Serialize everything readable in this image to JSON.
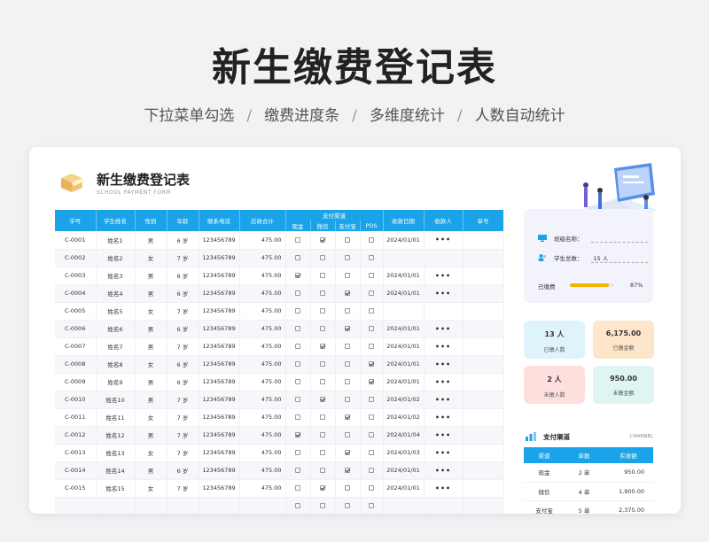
{
  "hero": {
    "title": "新生缴费登记表",
    "features": [
      "下拉菜单勾选",
      "缴费进度条",
      "多维度统计",
      "人数自动统计"
    ],
    "separator": "/"
  },
  "form": {
    "title": "新生缴费登记表",
    "subtitle": "SCHOOL PAYMENT FORM",
    "columns": [
      "学号",
      "学生姓名",
      "性别",
      "年龄",
      "联系电话",
      "应收合计",
      "支付渠道",
      "收款日期",
      "收款人",
      "单号"
    ],
    "pay_channels": [
      "现金",
      "微信",
      "支付宝",
      "POS"
    ],
    "rows": [
      {
        "id": "C-0001",
        "name": "姓名1",
        "gender": "男",
        "age": "6 岁",
        "phone": "123456789",
        "amount": "475.00",
        "pay": [
          0,
          1,
          0,
          0
        ],
        "date": "2024/01/01",
        "receiver": "•••"
      },
      {
        "id": "C-0002",
        "name": "姓名2",
        "gender": "女",
        "age": "7 岁",
        "phone": "123456789",
        "amount": "475.00",
        "pay": [
          0,
          0,
          0,
          0
        ],
        "date": "",
        "receiver": ""
      },
      {
        "id": "C-0003",
        "name": "姓名3",
        "gender": "男",
        "age": "6 岁",
        "phone": "123456789",
        "amount": "475.00",
        "pay": [
          1,
          0,
          0,
          0
        ],
        "date": "2024/01/01",
        "receiver": "•••"
      },
      {
        "id": "C-0004",
        "name": "姓名4",
        "gender": "男",
        "age": "6 岁",
        "phone": "123456789",
        "amount": "475.00",
        "pay": [
          0,
          0,
          1,
          0
        ],
        "date": "2024/01/01",
        "receiver": "•••"
      },
      {
        "id": "C-0005",
        "name": "姓名5",
        "gender": "女",
        "age": "7 岁",
        "phone": "123456789",
        "amount": "475.00",
        "pay": [
          0,
          0,
          0,
          0
        ],
        "date": "",
        "receiver": ""
      },
      {
        "id": "C-0006",
        "name": "姓名6",
        "gender": "男",
        "age": "6 岁",
        "phone": "123456789",
        "amount": "475.00",
        "pay": [
          0,
          0,
          1,
          0
        ],
        "date": "2024/01/01",
        "receiver": "•••"
      },
      {
        "id": "C-0007",
        "name": "姓名7",
        "gender": "男",
        "age": "7 岁",
        "phone": "123456789",
        "amount": "475.00",
        "pay": [
          0,
          1,
          0,
          0
        ],
        "date": "2024/01/01",
        "receiver": "•••"
      },
      {
        "id": "C-0008",
        "name": "姓名8",
        "gender": "女",
        "age": "6 岁",
        "phone": "123456789",
        "amount": "475.00",
        "pay": [
          0,
          0,
          0,
          1
        ],
        "date": "2024/01/01",
        "receiver": "•••"
      },
      {
        "id": "C-0009",
        "name": "姓名9",
        "gender": "男",
        "age": "6 岁",
        "phone": "123456789",
        "amount": "475.00",
        "pay": [
          0,
          0,
          0,
          1
        ],
        "date": "2024/01/01",
        "receiver": "•••"
      },
      {
        "id": "C-0010",
        "name": "姓名10",
        "gender": "男",
        "age": "7 岁",
        "phone": "123456789",
        "amount": "475.00",
        "pay": [
          0,
          1,
          0,
          0
        ],
        "date": "2024/01/02",
        "receiver": "•••"
      },
      {
        "id": "C-0011",
        "name": "姓名11",
        "gender": "女",
        "age": "7 岁",
        "phone": "123456789",
        "amount": "475.00",
        "pay": [
          0,
          0,
          1,
          0
        ],
        "date": "2024/01/02",
        "receiver": "•••"
      },
      {
        "id": "C-0012",
        "name": "姓名12",
        "gender": "男",
        "age": "7 岁",
        "phone": "123456789",
        "amount": "475.00",
        "pay": [
          1,
          0,
          0,
          0
        ],
        "date": "2024/01/04",
        "receiver": "•••"
      },
      {
        "id": "C-0013",
        "name": "姓名13",
        "gender": "女",
        "age": "7 岁",
        "phone": "123456789",
        "amount": "475.00",
        "pay": [
          0,
          0,
          1,
          0
        ],
        "date": "2024/01/03",
        "receiver": "•••"
      },
      {
        "id": "C-0014",
        "name": "姓名14",
        "gender": "男",
        "age": "6 岁",
        "phone": "123456789",
        "amount": "475.00",
        "pay": [
          0,
          0,
          1,
          0
        ],
        "date": "2024/01/01",
        "receiver": "•••"
      },
      {
        "id": "C-0015",
        "name": "姓名15",
        "gender": "女",
        "age": "7 岁",
        "phone": "123456789",
        "amount": "475.00",
        "pay": [
          0,
          1,
          0,
          0
        ],
        "date": "2024/01/01",
        "receiver": "•••"
      },
      {
        "id": "",
        "name": "",
        "gender": "",
        "age": "",
        "phone": "",
        "amount": "",
        "pay": [
          0,
          0,
          0,
          0
        ],
        "date": "",
        "receiver": ""
      }
    ]
  },
  "info": {
    "class_label": "班级名称：",
    "total_label": "学生总数：",
    "total_value": "15 人",
    "paid_label": "已缴费",
    "paid_pct": "87%",
    "paid_fraction": 0.87
  },
  "stats": [
    {
      "num": "13 人",
      "label": "已缴人数",
      "bg": "#dff3fb"
    },
    {
      "num": "6,175.00",
      "label": "已缴金额",
      "bg": "#fde6c9"
    },
    {
      "num": "2 人",
      "label": "未缴人数",
      "bg": "#fde0dd"
    },
    {
      "num": "950.00",
      "label": "未缴金额",
      "bg": "#dff5f1"
    }
  ],
  "channel": {
    "title": "支付渠道",
    "title_en": "CHANNEL",
    "headers": [
      "渠道",
      "单数",
      "实收额"
    ],
    "rows": [
      {
        "name": "现金",
        "count": "2 单",
        "amount": "950.00"
      },
      {
        "name": "微信",
        "count": "4 单",
        "amount": "1,900.00"
      },
      {
        "name": "支付宝",
        "count": "5 单",
        "amount": "2,375.00"
      }
    ]
  },
  "colors": {
    "accent": "#1aa3e8",
    "progress": "#f5b301"
  }
}
